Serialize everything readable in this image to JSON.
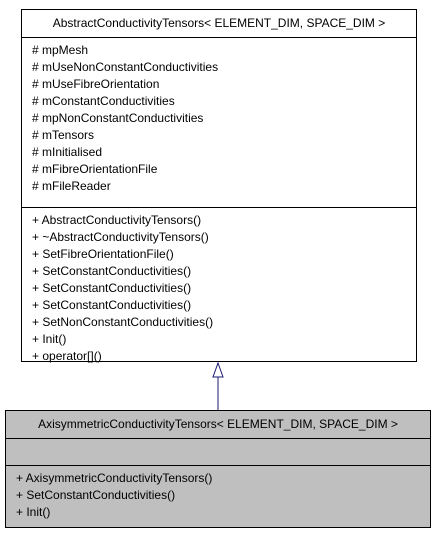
{
  "base_class": {
    "title": "AbstractConductivityTensors< ELEMENT_DIM, SPACE_DIM >",
    "attributes": [
      "# mpMesh",
      "# mUseNonConstantConductivities",
      "# mUseFibreOrientation",
      "# mConstantConductivities",
      "# mpNonConstantConductivities",
      "# mTensors",
      "# mInitialised",
      "# mFibreOrientationFile",
      "# mFileReader"
    ],
    "operations": [
      "+ AbstractConductivityTensors()",
      "+ ~AbstractConductivityTensors()",
      "+ SetFibreOrientationFile()",
      "+ SetConstantConductivities()",
      "+ SetConstantConductivities()",
      "+ SetConstantConductivities()",
      "+ SetNonConstantConductivities()",
      "+ Init()",
      "+ operator[]()"
    ]
  },
  "derived_class": {
    "title": "AxisymmetricConductivityTensors< ELEMENT_DIM, SPACE_DIM >",
    "attributes": [],
    "operations": [
      "+ AxisymmetricConductivityTensors()",
      "+ SetConstantConductivities()",
      "+ Init()"
    ]
  },
  "colors": {
    "arrow": "#191970",
    "derived_fill": "#bfbfbf",
    "base_fill": "#ffffff"
  }
}
